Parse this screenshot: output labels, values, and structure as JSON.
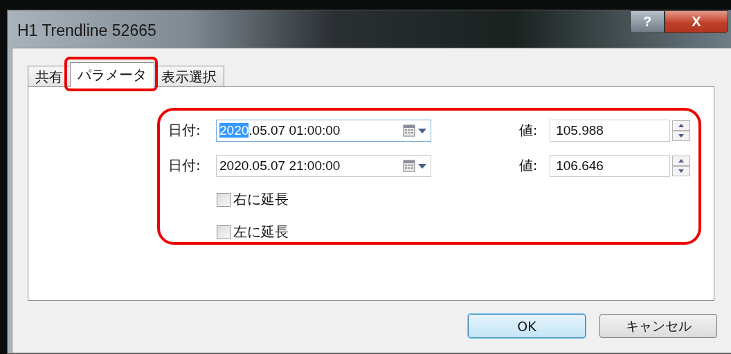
{
  "window": {
    "title": "H1 Trendline 52665",
    "help_button": "?",
    "close_button": "X"
  },
  "tabs": [
    {
      "label": "共有",
      "selected": false,
      "highlighted": false
    },
    {
      "label": "パラメータ",
      "selected": true,
      "highlighted": true
    },
    {
      "label": "表示選択",
      "selected": false,
      "highlighted": false
    }
  ],
  "parameters": {
    "highlighted": true,
    "points": [
      {
        "date_label": "日付:",
        "date_selected_part": "2020",
        "date_rest": ".05.07 01:00:00",
        "focused": true,
        "value_label": "値:",
        "value": "105.988"
      },
      {
        "date_label": "日付:",
        "date_rest": "2020.05.07 21:00:00",
        "focused": false,
        "value_label": "値:",
        "value": "106.646"
      }
    ],
    "checkboxes": [
      {
        "label": "右に延長",
        "checked": false
      },
      {
        "label": "左に延長",
        "checked": false
      }
    ]
  },
  "buttons": [
    {
      "label": "OK",
      "default": true
    },
    {
      "label": "キャンセル",
      "default": false
    }
  ]
}
